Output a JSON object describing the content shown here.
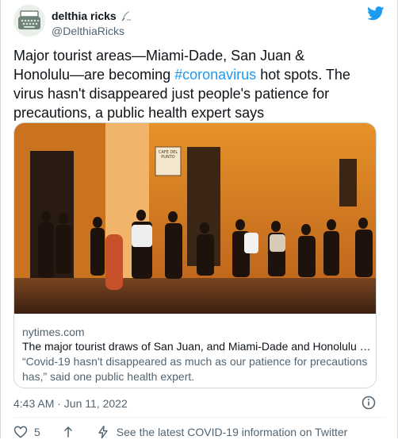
{
  "author": {
    "display_name": "delthia ricks",
    "handle": "@DelthiaRicks",
    "avatar_icon": "typewriter-icon",
    "badge_icon": "quill-pen-icon"
  },
  "tweet": {
    "text_before": "Major tourist areas—Miami-Dade, San Juan & Honolulu—are becoming ",
    "hashtag": "#coronavirus",
    "text_after": " hot spots. The virus hasn't disappeared just people's patience for precautions, a public health expert says",
    "timestamp": "4:43 AM · Jun 11, 2022"
  },
  "link_card": {
    "domain": "nytimes.com",
    "title": "The major tourist draws of San Juan, and Miami-Dade and Honolulu coun...",
    "description": "“Covid-19 hasn't disappeared as much as our patience for precautions has,” said one public health expert.",
    "sign_text": "CAFE DEL PUNTO"
  },
  "actions": {
    "like_count": "5",
    "covid_info_label": "See the latest COVID-19 information on Twitter"
  },
  "colors": {
    "accent": "#1d9bf0",
    "text": "#0f1419",
    "muted": "#536471"
  }
}
